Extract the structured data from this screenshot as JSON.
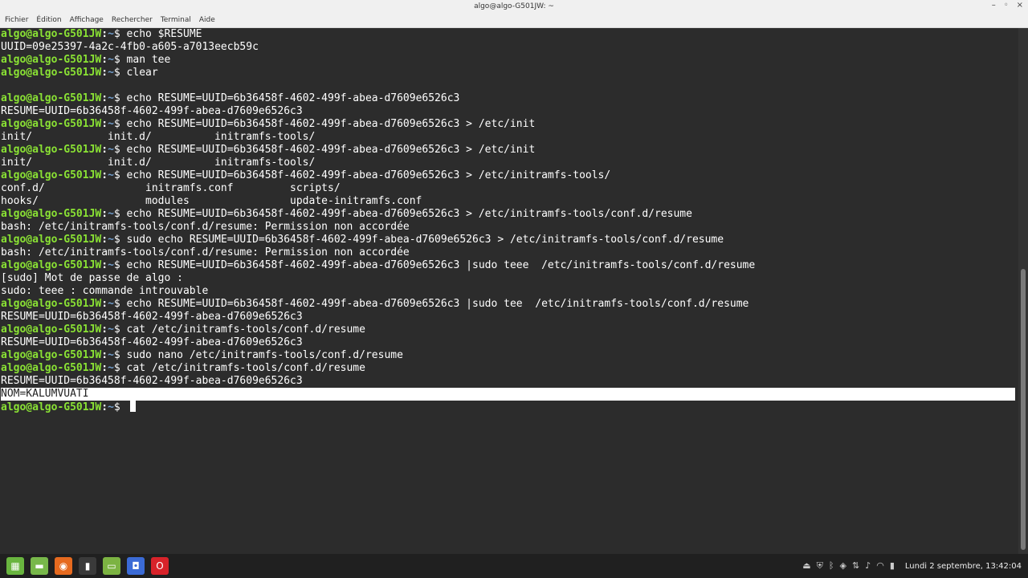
{
  "window": {
    "title": "algo@algo-G501JW: ~",
    "controls": [
      "–",
      "◦",
      "×"
    ]
  },
  "menu": [
    "Fichier",
    "Édition",
    "Affichage",
    "Rechercher",
    "Terminal",
    "Aide"
  ],
  "prompt": {
    "user_host": "algo@algo-G501JW",
    "sep": ":",
    "path": "~",
    "symbol": "$ "
  },
  "lines": [
    {
      "type": "cmd",
      "text": "echo $RESUME"
    },
    {
      "type": "out",
      "text": "UUID=09e25397-4a2c-4fb0-a605-a7013eecb59c"
    },
    {
      "type": "cmd",
      "text": "man tee"
    },
    {
      "type": "cmd",
      "text": "clear"
    },
    {
      "type": "blank",
      "text": ""
    },
    {
      "type": "cmd",
      "text": "echo RESUME=UUID=6b36458f-4602-499f-abea-d7609e6526c3"
    },
    {
      "type": "out",
      "text": "RESUME=UUID=6b36458f-4602-499f-abea-d7609e6526c3"
    },
    {
      "type": "cmd",
      "text": "echo RESUME=UUID=6b36458f-4602-499f-abea-d7609e6526c3 > /etc/init"
    },
    {
      "type": "out",
      "text": "init/            init.d/          initramfs-tools/"
    },
    {
      "type": "cmd",
      "text": "echo RESUME=UUID=6b36458f-4602-499f-abea-d7609e6526c3 > /etc/init"
    },
    {
      "type": "out",
      "text": "init/            init.d/          initramfs-tools/"
    },
    {
      "type": "cmd",
      "text": "echo RESUME=UUID=6b36458f-4602-499f-abea-d7609e6526c3 > /etc/initramfs-tools/"
    },
    {
      "type": "out",
      "text": "conf.d/                initramfs.conf         scripts/"
    },
    {
      "type": "out",
      "text": "hooks/                 modules                update-initramfs.conf"
    },
    {
      "type": "cmd",
      "text": "echo RESUME=UUID=6b36458f-4602-499f-abea-d7609e6526c3 > /etc/initramfs-tools/conf.d/resume"
    },
    {
      "type": "out",
      "text": "bash: /etc/initramfs-tools/conf.d/resume: Permission non accordée"
    },
    {
      "type": "cmd",
      "text": "sudo echo RESUME=UUID=6b36458f-4602-499f-abea-d7609e6526c3 > /etc/initramfs-tools/conf.d/resume"
    },
    {
      "type": "out",
      "text": "bash: /etc/initramfs-tools/conf.d/resume: Permission non accordée"
    },
    {
      "type": "cmd",
      "text": "echo RESUME=UUID=6b36458f-4602-499f-abea-d7609e6526c3 |sudo teee  /etc/initramfs-tools/conf.d/resume"
    },
    {
      "type": "out",
      "text": "[sudo] Mot de passe de algo : "
    },
    {
      "type": "out",
      "text": "sudo: teee : commande introuvable"
    },
    {
      "type": "cmd",
      "text": "echo RESUME=UUID=6b36458f-4602-499f-abea-d7609e6526c3 |sudo tee  /etc/initramfs-tools/conf.d/resume"
    },
    {
      "type": "out",
      "text": "RESUME=UUID=6b36458f-4602-499f-abea-d7609e6526c3"
    },
    {
      "type": "cmd",
      "text": "cat /etc/initramfs-tools/conf.d/resume"
    },
    {
      "type": "out",
      "text": "RESUME=UUID=6b36458f-4602-499f-abea-d7609e6526c3"
    },
    {
      "type": "cmd",
      "text": "sudo nano /etc/initramfs-tools/conf.d/resume"
    },
    {
      "type": "cmd",
      "text": "cat /etc/initramfs-tools/conf.d/resume"
    },
    {
      "type": "out",
      "text": "RESUME=UUID=6b36458f-4602-499f-abea-d7609e6526c3"
    },
    {
      "type": "selected",
      "text": "NOM=KALUMVUATI"
    },
    {
      "type": "current",
      "text": ""
    }
  ],
  "taskbar": {
    "apps": [
      {
        "name": "menu-icon",
        "color": "#69b53f",
        "glyph": "▦"
      },
      {
        "name": "show-desktop-icon",
        "color": "#78b84a",
        "glyph": "▬"
      },
      {
        "name": "firefox-icon",
        "color": "#e66a1f",
        "glyph": "◉"
      },
      {
        "name": "terminal-icon",
        "color": "#3a3a3a",
        "glyph": "▮"
      },
      {
        "name": "files-icon",
        "color": "#7cb342",
        "glyph": "▭"
      },
      {
        "name": "screenshot-icon",
        "color": "#3b6bd6",
        "glyph": "◘"
      },
      {
        "name": "opera-icon",
        "color": "#d8232a",
        "glyph": "O"
      }
    ],
    "tray_icons": [
      "eject-icon",
      "shield-icon",
      "bluetooth-icon",
      "nvidia-icon",
      "network-icon",
      "volume-icon",
      "wifi-icon",
      "battery-icon"
    ],
    "clock": "Lundi 2 septembre, 13:42:04"
  }
}
